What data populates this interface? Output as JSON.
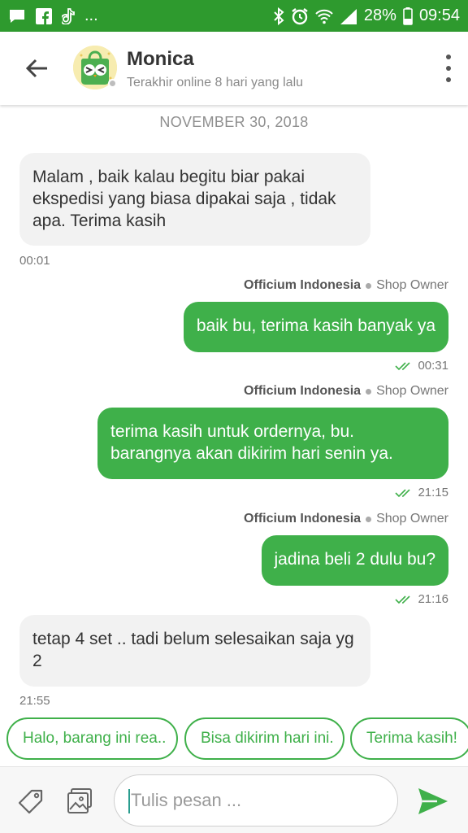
{
  "status_bar": {
    "battery": "28%",
    "time": "09:54",
    "more": "...",
    "left_icons": [
      "chat-icon",
      "facebook-icon",
      "tiktok-icon"
    ],
    "right_icons": [
      "bluetooth-icon",
      "alarm-icon",
      "wifi-icon",
      "signal-icon",
      "battery-icon"
    ]
  },
  "header": {
    "contact_name": "Monica",
    "status": "Terakhir online 8 hari yang lalu",
    "back_icon": "arrow-back-icon",
    "menu_icon": "more-vert-icon"
  },
  "chat": {
    "date": "NOVEMBER 30, 2018",
    "messages": [
      {
        "direction": "in",
        "text": "Malam , baik kalau begitu biar pakai ekspedisi yang biasa dipakai saja , tidak apa. Terima kasih",
        "time": "00:01"
      },
      {
        "direction": "out",
        "sender": "Officium Indonesia",
        "role": "Shop Owner",
        "text": "baik bu, terima kasih banyak ya",
        "time": "00:31"
      },
      {
        "direction": "out",
        "sender": "Officium Indonesia",
        "role": "Shop Owner",
        "text": "terima kasih untuk ordernya, bu. barangnya akan dikirim hari senin ya.",
        "time": "21:15"
      },
      {
        "direction": "out",
        "sender": "Officium Indonesia",
        "role": "Shop Owner",
        "text": "jadina beli 2 dulu bu?",
        "time": "21:16"
      },
      {
        "direction": "in",
        "text": "tetap 4 set .. tadi belum selesaikan saja yg 2",
        "time": "21:55"
      }
    ]
  },
  "quick_replies": [
    "Halo, barang ini rea..",
    "Bisa dikirim hari ini.",
    "Terima kasih!"
  ],
  "input": {
    "placeholder": "Tulis pesan ...",
    "value": ""
  },
  "colors": {
    "status_bar": "#2e9a2e",
    "accent": "#3fb04a",
    "incoming_bubble": "#f2f2f2"
  }
}
